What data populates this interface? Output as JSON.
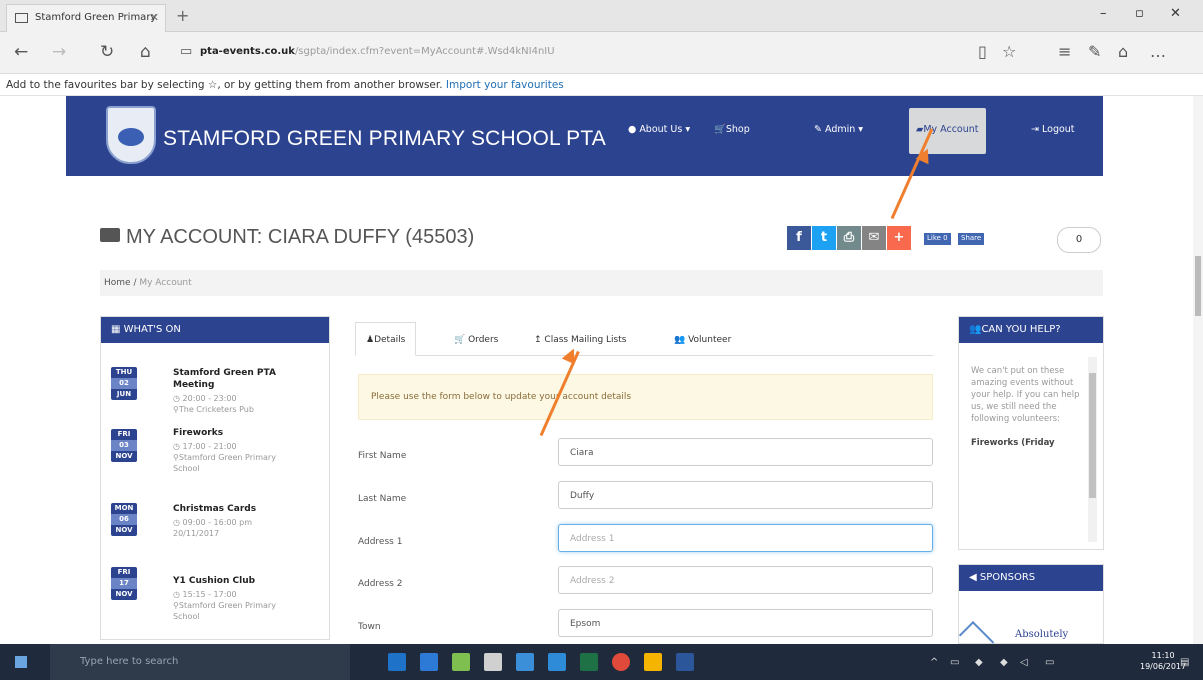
{
  "browser": {
    "tab_title": "Stamford Green Primary",
    "url_host": "pta-events.co.uk",
    "url_path": "/sgpta/index.cfm?event=MyAccount#.Wsd4kNI4nIU",
    "fav_text": "Add to the favourites bar by selecting ☆, or by getting them from another browser.",
    "fav_link": "Import your favourites"
  },
  "site": {
    "name": "STAMFORD GREEN PRIMARY SCHOOL PTA",
    "nav": {
      "about": "About Us ▾",
      "shop": "Shop",
      "admin": "Admin ▾",
      "my_account": "My Account",
      "logout": "Logout"
    }
  },
  "page": {
    "heading": "MY ACCOUNT: CIARA DUFFY (45503)",
    "share_count": "0",
    "fb_like": "Like 0",
    "fb_share": "Share",
    "breadcrumb": {
      "home": "Home",
      "current": "My Account"
    }
  },
  "whats_on": {
    "title": "WHAT'S ON",
    "events": [
      {
        "day": "THU",
        "date": "02",
        "month": "JUN",
        "title": "Stamford Green PTA Meeting",
        "time": "20:00 - 23:00",
        "place": "The Cricketers Pub"
      },
      {
        "day": "FRI",
        "date": "03",
        "month": "NOV",
        "title": "Fireworks",
        "time": "17:00 - 21:00",
        "place": "Stamford Green Primary School"
      },
      {
        "day": "MON",
        "date": "06",
        "month": "NOV",
        "title": "Christmas Cards",
        "time": "09:00 - 16:00 pm",
        "place": "20/11/2017"
      },
      {
        "day": "FRI",
        "date": "17",
        "month": "NOV",
        "title": "Y1 Cushion Club",
        "time": "15:15 - 17:00",
        "place": "Stamford Green Primary School"
      }
    ]
  },
  "tabs": {
    "details": "Details",
    "orders": "Orders",
    "mailing": "Class Mailing Lists",
    "volunteer": "Volunteer"
  },
  "form": {
    "alert": "Please use the form below to update your account details",
    "first_name_label": "First Name",
    "first_name": "Ciara",
    "last_name_label": "Last Name",
    "last_name": "Duffy",
    "address1_label": "Address 1",
    "address1_placeholder": "Address 1",
    "address2_label": "Address 2",
    "address2_placeholder": "Address 2",
    "town_label": "Town",
    "town": "Epsom"
  },
  "help": {
    "title": "CAN YOU HELP?",
    "text": "We can't put on these amazing events without your help. If you can help us, we still need the following volunteers:",
    "item": "Fireworks (Friday"
  },
  "sponsors": {
    "title": "SPONSORS",
    "first": "Absolutely"
  },
  "taskbar": {
    "search": "Type here to search",
    "time": "11:10",
    "date": "19/06/2017"
  },
  "colors": {
    "brand": "#2c4390",
    "arrow": "#f07f2d",
    "alert_bg": "#fcf8e3"
  }
}
